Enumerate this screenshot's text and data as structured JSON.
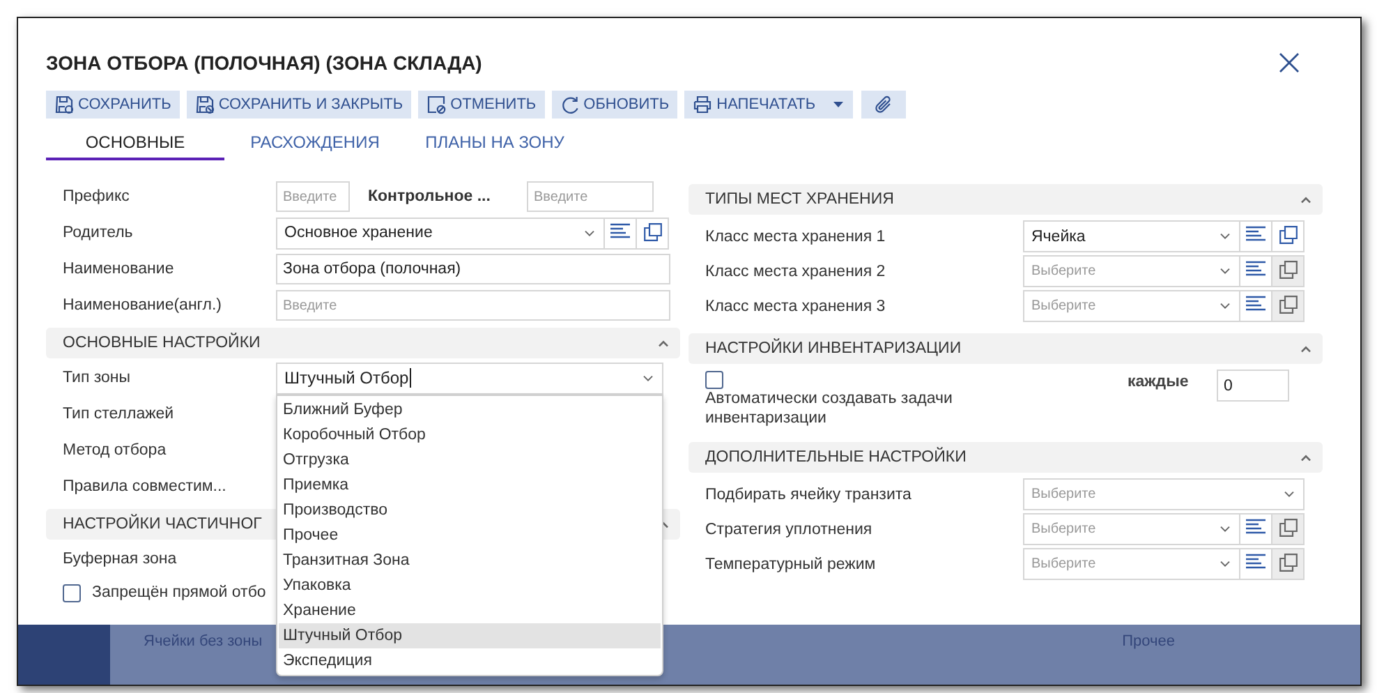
{
  "window": {
    "title": "ЗОНА ОТБОРА (ПОЛОЧНАЯ) (ЗОНА СКЛАДА)"
  },
  "toolbar": [
    {
      "kind": "save",
      "label": "СОХРАНИТЬ"
    },
    {
      "kind": "save-close",
      "label": "СОХРАНИТЬ И ЗАКРЫТЬ"
    },
    {
      "kind": "cancel",
      "label": "ОТМЕНИТЬ"
    },
    {
      "kind": "refresh",
      "label": "ОБНОВИТЬ"
    },
    {
      "kind": "print",
      "label": "НАПЕЧАТАТЬ"
    },
    {
      "kind": "attach"
    }
  ],
  "tabs": [
    {
      "label": "ОСНОВНЫЕ",
      "selected": true
    },
    {
      "label": "РАСХОЖДЕНИЯ",
      "selected": false
    },
    {
      "label": "ПЛАНЫ НА ЗОНУ",
      "selected": false
    }
  ],
  "general": [
    {
      "kind": "pair",
      "label": "Префикс",
      "placeholder": "Введите",
      "label_2": "Контрольное ...",
      "placeholder_2": "Введите"
    },
    {
      "kind": "select",
      "label": "Родитель",
      "value": "Основное хранение",
      "actions": true,
      "copy_disabled": false
    },
    {
      "kind": "text",
      "label": "Наименование",
      "value": "Зона отбора (полочная)"
    },
    {
      "kind": "text",
      "label": "Наименование(англ.)",
      "placeholder": "Введите"
    }
  ],
  "sections_left": [
    {
      "title": "ОСНОВНЫЕ НАСТРОЙКИ",
      "expanded": true,
      "rows": [
        {
          "kind": "combo",
          "label": "Тип зоны",
          "value": "Штучный Отбор",
          "options": [
            {
              "label": "Ближний Буфер",
              "selected": false
            },
            {
              "label": "Коробочный Отбор",
              "selected": false
            },
            {
              "label": "Отгрузка",
              "selected": false
            },
            {
              "label": "Приемка",
              "selected": false
            },
            {
              "label": "Производство",
              "selected": false
            },
            {
              "label": "Прочее",
              "selected": false
            },
            {
              "label": "Транзитная Зона",
              "selected": false
            },
            {
              "label": "Упаковка",
              "selected": false
            },
            {
              "label": "Хранение",
              "selected": false
            },
            {
              "label": "Штучный Отбор",
              "selected": true
            },
            {
              "label": "Экспедиция",
              "selected": false
            }
          ]
        },
        {
          "kind": "label",
          "label": "Тип стеллажей"
        },
        {
          "kind": "label",
          "label": "Метод отбора"
        },
        {
          "kind": "label",
          "label": "Правила совместим..."
        }
      ]
    },
    {
      "title": "НАСТРОЙКИ ЧАСТИЧНОГ",
      "expanded": true,
      "rows": [
        {
          "kind": "label",
          "label": "Буферная зона"
        },
        {
          "kind": "checkbox",
          "label": "Запрещён прямой отбо",
          "checked": false
        }
      ]
    }
  ],
  "sections_right": [
    {
      "title": "ТИПЫ МЕСТ ХРАНЕНИЯ",
      "expanded": true,
      "rows": [
        {
          "kind": "select",
          "label": "Класс места хранения 1",
          "value": "Ячейка",
          "actions": true,
          "copy_disabled": false
        },
        {
          "kind": "select",
          "label": "Класс места хранения 2",
          "placeholder": "Выберите",
          "actions": true,
          "copy_disabled": true
        },
        {
          "kind": "select",
          "label": "Класс места хранения 3",
          "placeholder": "Выберите",
          "actions": true,
          "copy_disabled": true
        }
      ]
    },
    {
      "title": "НАСТРОЙКИ ИНВЕНТАРИЗАЦИИ",
      "expanded": true,
      "rows": [
        {
          "kind": "checkbox-every",
          "label": "Автоматически создавать задачи инвентаризации",
          "checked": false,
          "every_label": "каждые",
          "every_value": "0"
        }
      ]
    },
    {
      "title": "ДОПОЛНИТЕЛЬНЫЕ НАСТРОЙКИ",
      "expanded": true,
      "rows": [
        {
          "kind": "select",
          "label": "Подбирать ячейку транзита",
          "placeholder": "Выберите",
          "actions": false
        },
        {
          "kind": "select",
          "label": "Стратегия уплотнения",
          "placeholder": "Выберите",
          "actions": true,
          "copy_disabled": true
        },
        {
          "kind": "select",
          "label": "Температурный режим",
          "placeholder": "Выберите",
          "actions": true,
          "copy_disabled": true
        }
      ]
    }
  ],
  "underlying_page": {
    "cells": [
      "Ячейки без зоны",
      "Прочее"
    ]
  }
}
